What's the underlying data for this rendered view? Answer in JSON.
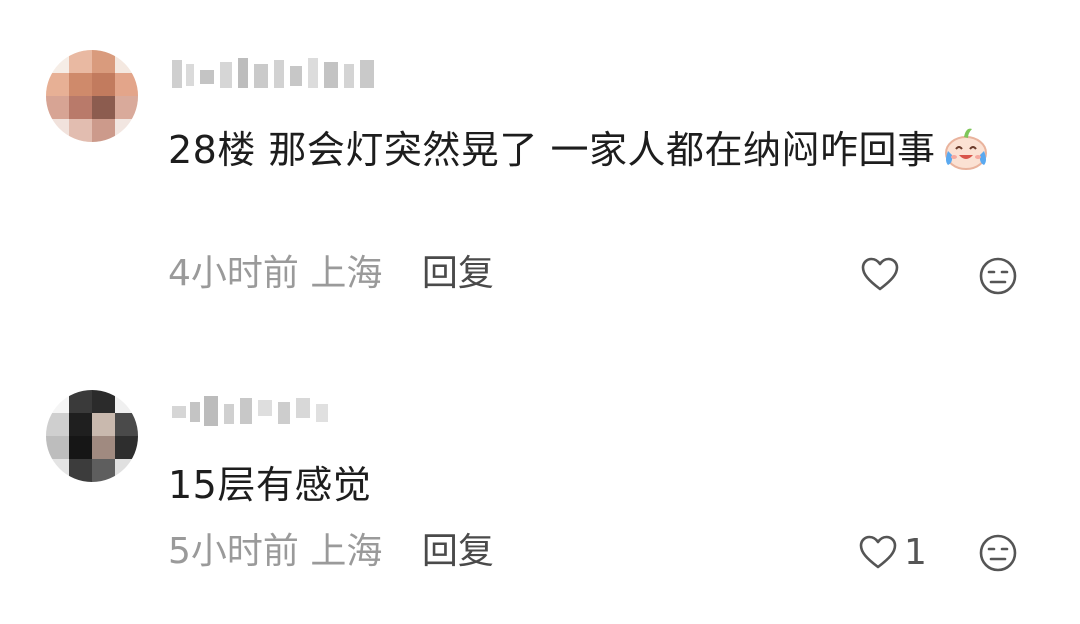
{
  "comments": [
    {
      "text": "28楼 那会灯突然晃了 一家人都在纳闷咋回事",
      "emoji": "laughing-crying-emoji",
      "time": "4小时前",
      "location": "上海",
      "reply_label": "回复",
      "like_count": "",
      "icons": {
        "like": "heart-outline-icon",
        "dislike": "meh-face-icon"
      }
    },
    {
      "text": "15层有感觉",
      "time": "5小时前",
      "location": "上海",
      "reply_label": "回复",
      "like_count": "1",
      "icons": {
        "like": "heart-outline-icon",
        "dislike": "meh-face-icon"
      }
    }
  ],
  "colors": {
    "text": "#1d1d1d",
    "meta": "#9a9a9a",
    "reply": "#4a4a4a",
    "icon": "#555555"
  }
}
